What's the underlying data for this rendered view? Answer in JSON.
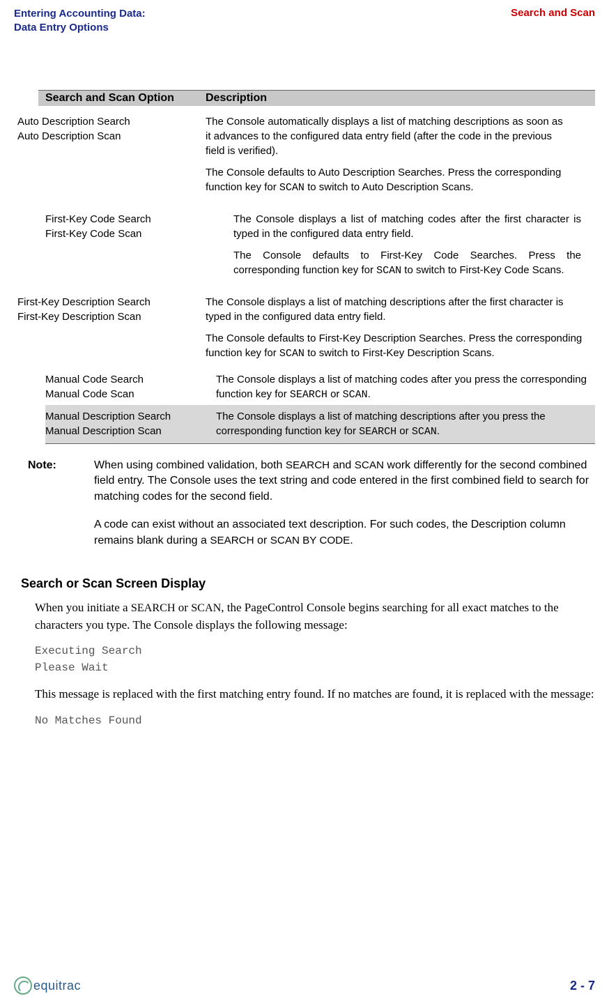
{
  "header": {
    "left_line1": "Entering Accounting Data:",
    "left_line2": "Data Entry Options",
    "right": "Search and Scan"
  },
  "table": {
    "col1_header": "Search and Scan Option",
    "col2_header": "Description",
    "rows": [
      {
        "opt1": "Auto Description Search",
        "opt2": "Auto Description Scan",
        "desc_p1": "The Console automatically displays a list of matching descriptions as soon as it advances to the configured data entry field (after the code in the previous field is verified).",
        "desc_p2a": "The Console defaults to Auto Description Searches. Press the corresponding function key for ",
        "desc_p2_code": "SCAN",
        "desc_p2b": " to switch to Auto Description Scans."
      },
      {
        "opt1": "First-Key Code Search",
        "opt2": "First-Key Code Scan",
        "desc_p1": "The Console displays a list of matching codes after the first character is typed in the configured data entry field.",
        "desc_p2a": "The Console defaults to First-Key Code Searches. Press the corresponding function key for ",
        "desc_p2_code": "SCAN",
        "desc_p2b": " to switch to First-Key Code Scans."
      },
      {
        "opt1": "First-Key Description Search",
        "opt2": "First-Key Description Scan",
        "desc_p1": "The Console displays a list of matching descriptions after the first character is typed in the configured data entry field.",
        "desc_p2a": "The Console defaults to First-Key Description Searches. Press the corresponding function key for ",
        "desc_p2_code": "SCAN",
        "desc_p2b": " to switch to First-Key Description Scans."
      },
      {
        "opt1": "Manual Code Search",
        "opt2": "Manual Code Scan",
        "desc_a": "The Console displays a list of matching codes after you press the corresponding function key for ",
        "desc_code1": "SEARCH",
        "desc_mid": " or ",
        "desc_code2": "SCAN",
        "desc_end": "."
      },
      {
        "opt1": "Manual Description Search",
        "opt2": "Manual Description Scan",
        "desc_a": "The Console displays a list of matching descriptions after you press the corresponding function key for ",
        "desc_code1": "SEARCH",
        "desc_mid": " or ",
        "desc_code2": "SCAN",
        "desc_end": "."
      }
    ]
  },
  "note": {
    "label": "Note:",
    "p1a": "When using combined validation, both ",
    "p1_sc1": "SEARCH",
    "p1b": " and ",
    "p1_sc2": "SCAN",
    "p1c": " work differently for the second combined field entry. The Console uses the text string and code entered in the first combined field to search for matching codes for the second field.",
    "p2a": "A code can exist without an associated text description. For such codes, the Description column remains blank during a ",
    "p2_sc1": "SEARCH",
    "p2b": " or ",
    "p2_sc2": "SCAN BY CODE",
    "p2c": "."
  },
  "section": {
    "heading": "Search or Scan Screen Display",
    "p1a": "When you initiate a ",
    "p1_sc1": "SEARCH",
    "p1b": " or ",
    "p1_sc2": "SCAN",
    "p1c": ", the PageControl Console begins searching for all exact matches to the characters you type. The Console displays the following message:",
    "code1_l1": "Executing Search",
    "code1_l2": "Please Wait",
    "p2": "This message is replaced with the first matching entry found. If no matches are found, it is replaced with the message:",
    "code2": "No Matches Found"
  },
  "footer": {
    "logo_text": "equitrac",
    "page": "2 - 7"
  }
}
